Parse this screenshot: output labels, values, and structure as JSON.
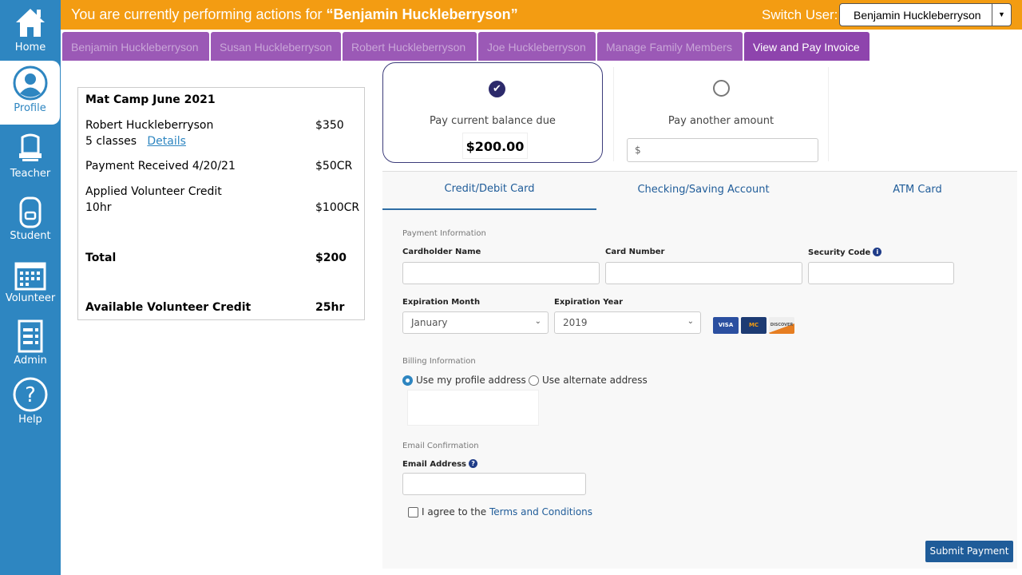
{
  "sidebar": {
    "items": [
      {
        "label": "Home"
      },
      {
        "label": "Profile"
      },
      {
        "label": "Teacher"
      },
      {
        "label": "Student"
      },
      {
        "label": "Volunteer"
      },
      {
        "label": "Admin"
      },
      {
        "label": "Help"
      }
    ]
  },
  "header": {
    "prefix": "You are currently  performing actions for ",
    "user": "“Benjamin  Huckleberryson”",
    "switch_label": "Switch User:",
    "switch_value": "Benjamin Huckleberryson"
  },
  "tabs": [
    {
      "label": "Benjamin Huckleberryson"
    },
    {
      "label": "Susan Huckleberryson"
    },
    {
      "label": "Robert Huckleberryson"
    },
    {
      "label": "Joe Huckleberryson"
    },
    {
      "label": "Manage Family Members"
    },
    {
      "label": "View and Pay Invoice"
    }
  ],
  "invoice": {
    "title": "Mat Camp June 2021",
    "student": "Robert Huckleberryson",
    "student_amount": "$350",
    "classes": "5 classes",
    "details_link": "Details",
    "payment": "Payment Received 4/20/21",
    "payment_amount": "$50CR",
    "credit": "Applied Volunteer  Credit",
    "credit_hours": "10hr",
    "credit_amount": "$100CR",
    "total_label": "Total",
    "total": "$200",
    "avail_label": "Available Volunteer Credit",
    "avail": "25hr"
  },
  "payment": {
    "option1": "Pay current balance due",
    "balance": "$200.00",
    "option2": "Pay another amount",
    "amount_placeholder": "$",
    "tabs": [
      "Credit/Debit Card",
      "Checking/Saving Account",
      "ATM Card"
    ],
    "section_payment": "Payment Information",
    "cardholder": "Cardholder Name",
    "card_number": "Card Number",
    "security": "Security Code",
    "exp_month": "Expiration Month",
    "exp_month_value": "January",
    "exp_year": "Expiration Year",
    "exp_year_value": "2019",
    "cards": [
      "VISA",
      "MC",
      "DISCOVER"
    ],
    "section_billing": "Billing Information",
    "profile_addr": "Use my profile address",
    "alt_addr": "Use alternate address",
    "section_email": "Email Confirmation",
    "email": "Email Address",
    "agree": "I agree to the ",
    "terms": "Terms and Conditions",
    "submit": "Submit Payment"
  },
  "colors": {
    "sidebar": "#2e86c1",
    "topbar": "#f39c12",
    "tab": "#9b59b6",
    "tab_active": "#8e44ad"
  }
}
